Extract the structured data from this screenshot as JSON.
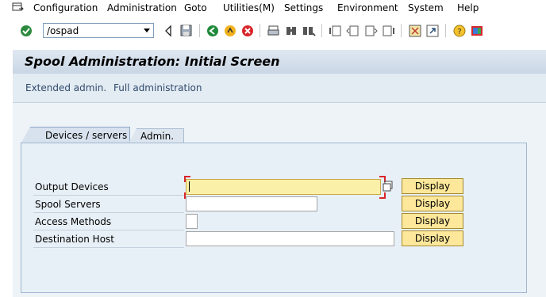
{
  "menu": {
    "items": [
      {
        "label": "Configuration"
      },
      {
        "label": "Administration"
      },
      {
        "label": "Goto"
      },
      {
        "label": "Utilities(M)"
      },
      {
        "label": "Settings"
      },
      {
        "label": "Environment"
      },
      {
        "label": "System"
      },
      {
        "label": "Help"
      }
    ]
  },
  "toolbar": {
    "command_value": "/ospad",
    "icons": [
      "enter-check-icon",
      "back-arrow-icon",
      "save-icon",
      "back-icon",
      "exit-icon",
      "cancel-icon",
      "print-icon",
      "find-icon",
      "find-next-icon",
      "first-page-icon",
      "previous-page-icon",
      "next-page-icon",
      "last-page-icon",
      "create-session-icon",
      "shortcut-icon",
      "help-icon",
      "layout-icon"
    ]
  },
  "screen": {
    "title": "Spool Administration: Initial Screen",
    "app_links": [
      "Extended admin.",
      "Full administration"
    ]
  },
  "tabs": [
    {
      "label": "Devices / servers",
      "active": true
    },
    {
      "label": "Admin.",
      "active": false
    }
  ],
  "fields": [
    {
      "label": "Output Devices",
      "value": "",
      "required": true,
      "button": "Display"
    },
    {
      "label": "Spool Servers",
      "value": "",
      "required": false,
      "button": "Display"
    },
    {
      "label": "Access Methods",
      "value": "",
      "required": false,
      "button": "Display"
    },
    {
      "label": "Destination Host",
      "value": "",
      "required": false,
      "button": "Display"
    }
  ],
  "colors": {
    "title_bg": "#dfe8f2",
    "required_field": "#fbf0a8",
    "button_bg": "#fde79a"
  }
}
